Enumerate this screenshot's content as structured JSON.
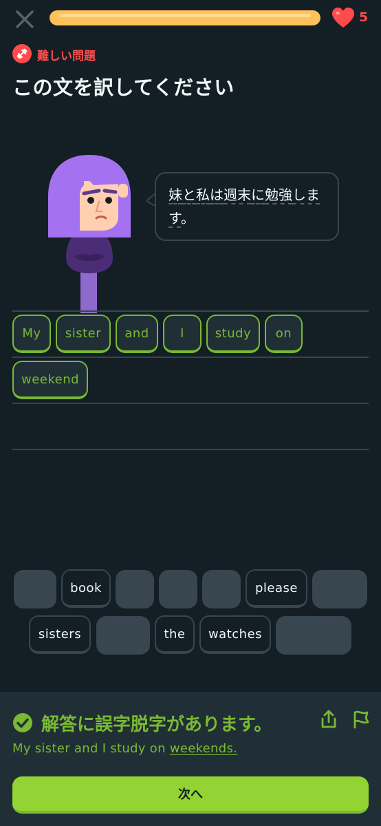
{
  "header": {
    "close_icon": "close-icon",
    "progress": 1.0,
    "hearts": "5",
    "colors": {
      "progress": "#ffc25a",
      "heart": "#ff4b4b"
    }
  },
  "challenge": {
    "badge_label": "難しい問題",
    "title": "この文を訳してください",
    "prompt_parts": [
      "妹",
      "と",
      "私",
      "は",
      "週末",
      "に",
      "勉強",
      "しま",
      "す",
      "。"
    ]
  },
  "answer_tiles": [
    "My",
    "sister",
    "and",
    "I",
    "study",
    "on",
    "weekend"
  ],
  "word_bank": {
    "row1": [
      "",
      "book",
      "",
      "",
      "",
      "please",
      ""
    ],
    "row2": [
      "sisters",
      "",
      "the",
      "watches",
      ""
    ]
  },
  "feedback": {
    "title": "解答に誤字脱字があります。",
    "answer_prefix": "My sister and I study on ",
    "answer_highlight": "weekends.",
    "next_label": "次へ",
    "colors": {
      "success": "#79b933",
      "button": "#93d333"
    }
  }
}
